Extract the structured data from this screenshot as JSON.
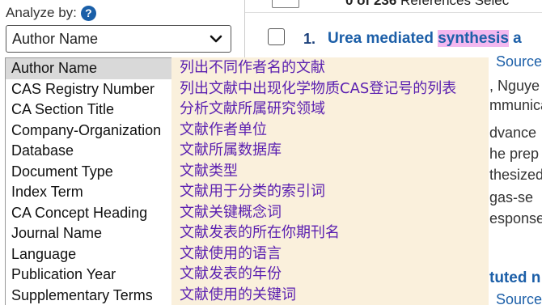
{
  "analyze": {
    "label": "Analyze by:",
    "help_glyph": "?",
    "selected": "Author Name"
  },
  "options": [
    {
      "label": "Author Name",
      "desc": "列出不同作者名的文献"
    },
    {
      "label": "CAS Registry Number",
      "desc": "列出文献中出现化学物质CAS登记号的列表"
    },
    {
      "label": "CA Section Title",
      "desc": "分析文献所属研究领域"
    },
    {
      "label": "Company-Organization",
      "desc": "文献作者单位"
    },
    {
      "label": "Database",
      "desc": "文献所属数据库"
    },
    {
      "label": "Document Type",
      "desc": "文献类型"
    },
    {
      "label": "Index Term",
      "desc": "文献用于分类的索引词"
    },
    {
      "label": "CA Concept Heading",
      "desc": "文献关键概念词"
    },
    {
      "label": "Journal Name",
      "desc": "文献发表的所在你期刊名"
    },
    {
      "label": "Language",
      "desc": "文献使用的语言"
    },
    {
      "label": "Publication Year",
      "desc": "文献发表的年份"
    },
    {
      "label": "Supplementary Terms",
      "desc": "文献使用的关键词"
    }
  ],
  "results": {
    "count_text": "0 of 236",
    "count_suffix": "References Selec",
    "item1_num": "1.",
    "item1_title_pre": "Urea mediated ",
    "item1_title_hl": "synthesis",
    "item1_title_post": " a",
    "frag_source1": "Source",
    "frag_author": ", Nguye",
    "frag_comm": "mmunica",
    "frag_adv": "dvance",
    "frag_prep": "he prep",
    "frag_thes": "thesized",
    "frag_gas": "gas-se",
    "frag_resp": "esponse",
    "item2_title": "tuted n",
    "frag_source2": "Source"
  }
}
